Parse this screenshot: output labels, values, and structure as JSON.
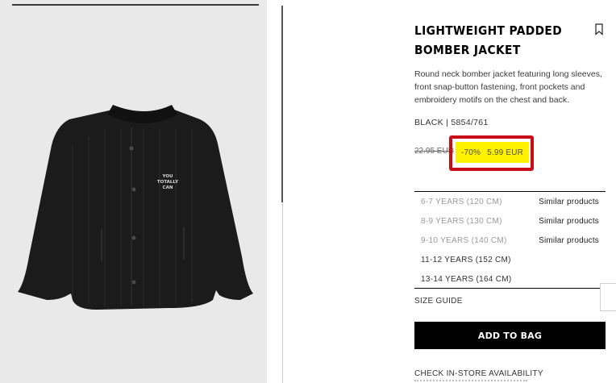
{
  "product": {
    "title": "LIGHTWEIGHT PADDED BOMBER JACKET",
    "description": "Round neck bomber jacket featuring long sleeves, front snap-button fastening, front pockets and embroidery motifs on the chest and back.",
    "color_ref": "BLACK | 5854/761",
    "embroidery_text": [
      "YOU",
      "TOTALLY",
      "CAN"
    ]
  },
  "price": {
    "old": "22.95 EUR",
    "discount": "-70%",
    "current": "5.99 EUR"
  },
  "sizes": [
    {
      "label": "6-7 YEARS (120 CM)",
      "available": false,
      "similar": "Similar products"
    },
    {
      "label": "8-9 YEARS (130 CM)",
      "available": false,
      "similar": "Similar products"
    },
    {
      "label": "9-10 YEARS (140 CM)",
      "available": false,
      "similar": "Similar products"
    },
    {
      "label": "11-12 YEARS (152 CM)",
      "available": true,
      "similar": ""
    },
    {
      "label": "13-14 YEARS (164 CM)",
      "available": true,
      "similar": ""
    }
  ],
  "actions": {
    "size_guide": "SIZE GUIDE",
    "add_to_bag": "ADD TO BAG",
    "store_availability": "CHECK IN-STORE AVAILABILITY"
  },
  "icons": {
    "bookmark": "bookmark-icon"
  },
  "colors": {
    "highlight": "#fff200",
    "highlight_border": "#c80d16",
    "button": "#000000"
  }
}
